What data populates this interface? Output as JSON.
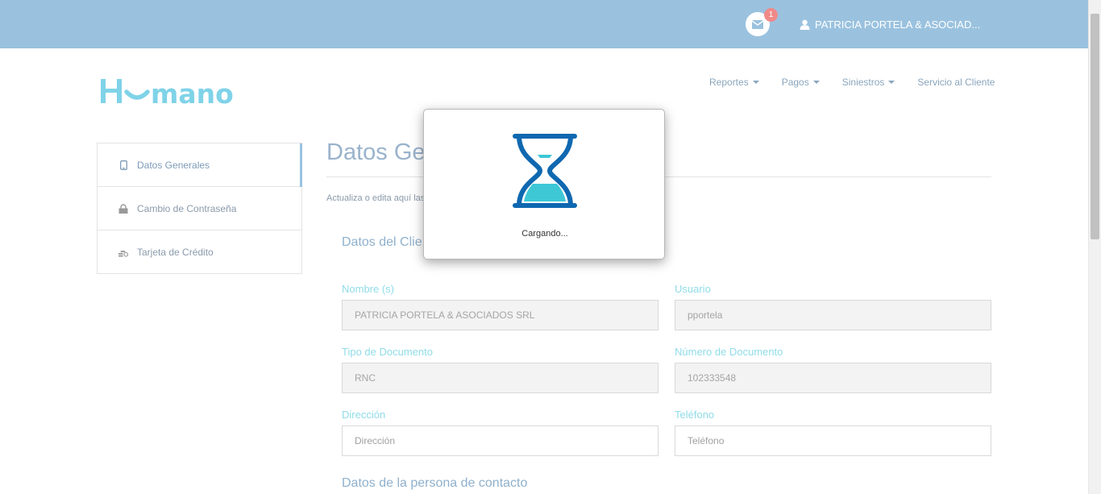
{
  "header": {
    "mail_badge_count": "1",
    "user_name": "PATRICIA PORTELA & ASOCIAD..."
  },
  "brand": {
    "logo_text": "Humano",
    "accent_color": "#7fd3e8",
    "topbar_color": "#9ac2df"
  },
  "nav": {
    "items": [
      {
        "label": "Reportes",
        "has_dropdown": true
      },
      {
        "label": "Pagos",
        "has_dropdown": true
      },
      {
        "label": "Siniestros",
        "has_dropdown": true
      },
      {
        "label": "Servicio al Cliente",
        "has_dropdown": false
      }
    ]
  },
  "sidebar": {
    "items": [
      {
        "label": "Datos Generales",
        "icon": "mobile-icon",
        "active": true
      },
      {
        "label": "Cambio de Contraseña",
        "icon": "lock-icon",
        "active": false
      },
      {
        "label": "Tarjeta de Crédito",
        "icon": "coins-icon",
        "active": false
      }
    ]
  },
  "main": {
    "title": "Datos Ge",
    "subtitle": "Actualiza o edita aquí las",
    "section_client": "Datos del Clie",
    "section_contact": "Datos de la persona de contacto",
    "fields": {
      "nombre": {
        "label": "Nombre (s)",
        "value": "PATRICIA PORTELA & ASOCIADOS SRL"
      },
      "usuario": {
        "label": "Usuario",
        "value": "pportela"
      },
      "tipo_documento": {
        "label": "Tipo de Documento",
        "value": "RNC"
      },
      "numero_documento": {
        "label": "Número de Documento",
        "value": "102333548"
      },
      "direccion": {
        "label": "Dirección",
        "placeholder": "Dirección"
      },
      "telefono": {
        "label": "Teléfono",
        "placeholder": "Teléfono"
      }
    }
  },
  "modal": {
    "loading_text": "Cargando..."
  }
}
